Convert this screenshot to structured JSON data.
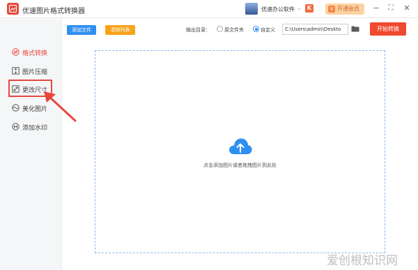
{
  "titlebar": {
    "app_title": "优速图片格式转换器",
    "brand_name": "优速办公软件",
    "brand_caret": "⌵",
    "brand_badge": "K",
    "vip_label": "开通会员",
    "vip_icon": "V",
    "minimize": "−",
    "maximize": "⛶",
    "close": "✕"
  },
  "sidebar": {
    "items": [
      {
        "label": "格式转换",
        "icon": "convert-icon",
        "active": true
      },
      {
        "label": "图片压缩",
        "icon": "compress-icon",
        "active": false
      },
      {
        "label": "更改尺寸",
        "icon": "resize-icon",
        "active": false
      },
      {
        "label": "美化图片",
        "icon": "beautify-icon",
        "active": false
      },
      {
        "label": "添加水印",
        "icon": "watermark-icon",
        "active": false
      }
    ]
  },
  "toolbar": {
    "add_files": "添加文件",
    "clear_list": "清除列表",
    "output_label": "输出目录：",
    "option_original": "原文件夹",
    "option_custom": "自定义",
    "selected_option": "自定义",
    "path_value": "C:\\Users\\admin\\Deskto",
    "start_button": "开始转换"
  },
  "dropzone": {
    "hint": "点击添加图片或者拖拽图片到此处"
  },
  "watermark": {
    "text": "爱创根知识网"
  },
  "colors": {
    "accent_red": "#e8473d",
    "primary_blue": "#2f8ff0",
    "orange": "#f9a21a",
    "start_red": "#f0492e"
  }
}
